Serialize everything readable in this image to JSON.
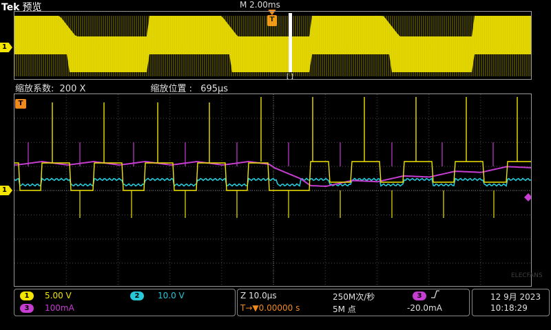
{
  "header": {
    "brand": "Tek",
    "mode": "预览",
    "timebase": "M 2.00ms"
  },
  "zoom": {
    "factor_label": "缩放系数:",
    "factor_value": "200 X",
    "position_label": "缩放位置 :",
    "position_value": "695μs"
  },
  "markers": {
    "ch1": "1",
    "trigger": "T",
    "trigger_small": "T",
    "zoom_bracket": "[ ]"
  },
  "channels": [
    {
      "num": "1",
      "scale": "5.00 V",
      "color": "#f3e500"
    },
    {
      "num": "2",
      "scale": "10.0 V",
      "color": "#27c9d8"
    },
    {
      "num": "3",
      "scale": "100mA",
      "color": "#c63dd1"
    }
  ],
  "acquisition": {
    "zoom_scale": "Z 10.0μs",
    "trig_pos_prefix": "T→▼",
    "trig_pos": "0.00000 s",
    "sample_rate": "250M次/秒",
    "record_length": "5M 点"
  },
  "trigger": {
    "source": "3",
    "slope_icon": "rising-edge-icon",
    "level": "-20.0mA"
  },
  "datetime": {
    "date": "12 9月 2023",
    "time": "10:18:29"
  },
  "watermark": "ELECFANS"
}
